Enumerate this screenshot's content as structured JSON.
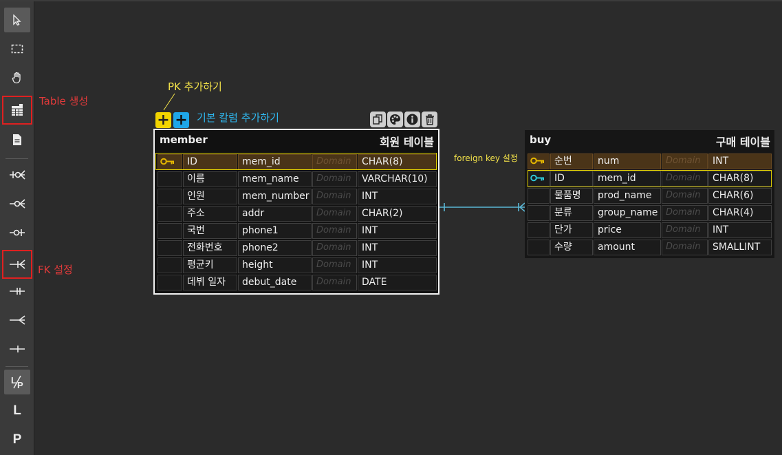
{
  "toolbar": {
    "buttons": [
      {
        "name": "select-icon"
      },
      {
        "name": "marquee-select-icon"
      },
      {
        "name": "hand-pan-icon"
      },
      {
        "name": "table-create-icon"
      },
      {
        "name": "memo-icon"
      },
      {
        "name": "relation-zero-one-n-icon"
      },
      {
        "name": "relation-zero-n-icon"
      },
      {
        "name": "relation-zero-one-icon"
      },
      {
        "name": "relation-one-n-icon"
      },
      {
        "name": "relation-one-one-icon"
      },
      {
        "name": "relation-n-icon"
      },
      {
        "name": "relation-one-icon"
      },
      {
        "name": "logical-physical-toggle-icon"
      },
      {
        "name": "logical-mode-icon",
        "label": "L"
      },
      {
        "name": "physical-mode-icon",
        "label": "P"
      }
    ]
  },
  "annotations": {
    "table_create": "Table 생성",
    "fk_setting": "FK 설정",
    "pk_add": "PK 추가하기",
    "column_add": "기본 칼럼 추가하기",
    "foreign_key": "foreign key 설정"
  },
  "add_buttons": {
    "pk": "+",
    "column": "+"
  },
  "member": {
    "name": "member",
    "comment": "회원 테이블",
    "columns": [
      {
        "logical": "ID",
        "physical": "mem_id",
        "domain": "Domain",
        "type": "CHAR(8)",
        "pk": true
      },
      {
        "logical": "이름",
        "physical": "mem_name",
        "domain": "Domain",
        "type": "VARCHAR(10)",
        "pk": false
      },
      {
        "logical": "인원",
        "physical": "mem_number",
        "domain": "Domain",
        "type": "INT",
        "pk": false
      },
      {
        "logical": "주소",
        "physical": "addr",
        "domain": "Domain",
        "type": "CHAR(2)",
        "pk": false
      },
      {
        "logical": "국번",
        "physical": "phone1",
        "domain": "Domain",
        "type": "INT",
        "pk": false
      },
      {
        "logical": "전화번호",
        "physical": "phone2",
        "domain": "Domain",
        "type": "INT",
        "pk": false
      },
      {
        "logical": "평균키",
        "physical": "height",
        "domain": "Domain",
        "type": "INT",
        "pk": false
      },
      {
        "logical": "데뷔 일자",
        "physical": "debut_date",
        "domain": "Domain",
        "type": "DATE",
        "pk": false
      }
    ]
  },
  "buy": {
    "name": "buy",
    "comment": "구매 테이블",
    "columns": [
      {
        "logical": "순번",
        "physical": "num",
        "domain": "Domain",
        "type": "INT",
        "pk": true
      },
      {
        "logical": "ID",
        "physical": "mem_id",
        "domain": "Domain",
        "type": "CHAR(8)",
        "pk": false,
        "fk": true
      },
      {
        "logical": "물품명",
        "physical": "prod_name",
        "domain": "Domain",
        "type": "CHAR(6)",
        "pk": false
      },
      {
        "logical": "분류",
        "physical": "group_name",
        "domain": "Domain",
        "type": "CHAR(4)",
        "pk": false
      },
      {
        "logical": "단가",
        "physical": "price",
        "domain": "Domain",
        "type": "INT",
        "pk": false
      },
      {
        "logical": "수량",
        "physical": "amount",
        "domain": "Domain",
        "type": "SMALLINT",
        "pk": false
      }
    ]
  },
  "colors": {
    "pk_key": "#e6b800",
    "fk_key": "#2fc6d6",
    "relation_line": "#5bb8d6",
    "highlight": "#e5d300",
    "annotation_red": "#e03a3a",
    "annotation_yellow": "#f4e34a",
    "annotation_blue": "#2fb8f0"
  }
}
